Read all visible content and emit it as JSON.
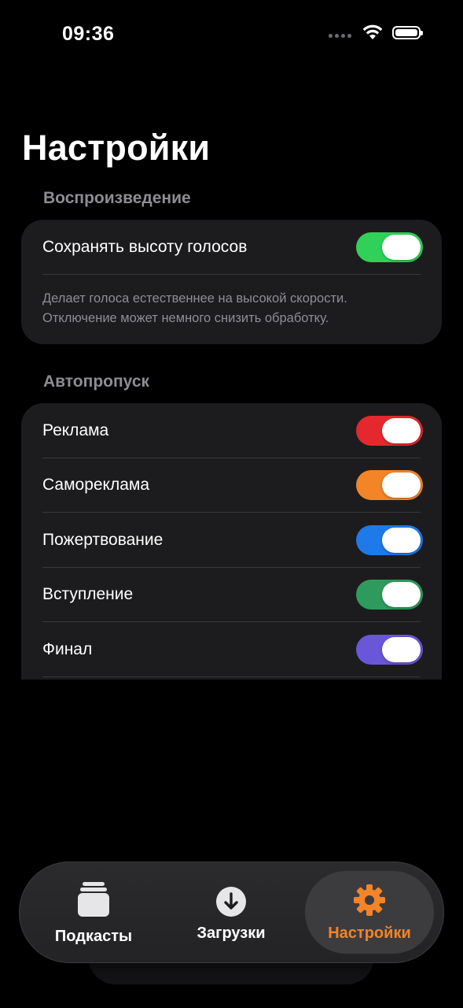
{
  "status_bar": {
    "time": "09:36"
  },
  "page": {
    "title": "Настройки"
  },
  "playback": {
    "header": "Воспроизведение",
    "preserve_pitch": {
      "label": "Сохранять высоту голосов",
      "on": true,
      "color": "#30d158"
    },
    "footer_line1": "Делает голоса естественнее на высокой скорости.",
    "footer_line2": "Отключение может немного снизить обработку."
  },
  "autoskip": {
    "header": "Автопропуск",
    "items": [
      {
        "label": "Реклама",
        "on": true,
        "color": "#e5282e"
      },
      {
        "label": "Самореклама",
        "on": true,
        "color": "#f38428"
      },
      {
        "label": "Пожертвование",
        "on": true,
        "color": "#1e7ae8"
      },
      {
        "label": "Вступление",
        "on": true,
        "color": "#2e9a5e"
      },
      {
        "label": "Финал",
        "on": true,
        "color": "#6a56d8"
      }
    ]
  },
  "tab_bar": {
    "tabs": [
      {
        "label": "Подкасты",
        "icon": "podcasts-stack-icon",
        "selected": false
      },
      {
        "label": "Загрузки",
        "icon": "download-arrow-icon",
        "selected": false
      },
      {
        "label": "Настройки",
        "icon": "gear-icon",
        "selected": true
      }
    ],
    "accent": "#f38428"
  }
}
